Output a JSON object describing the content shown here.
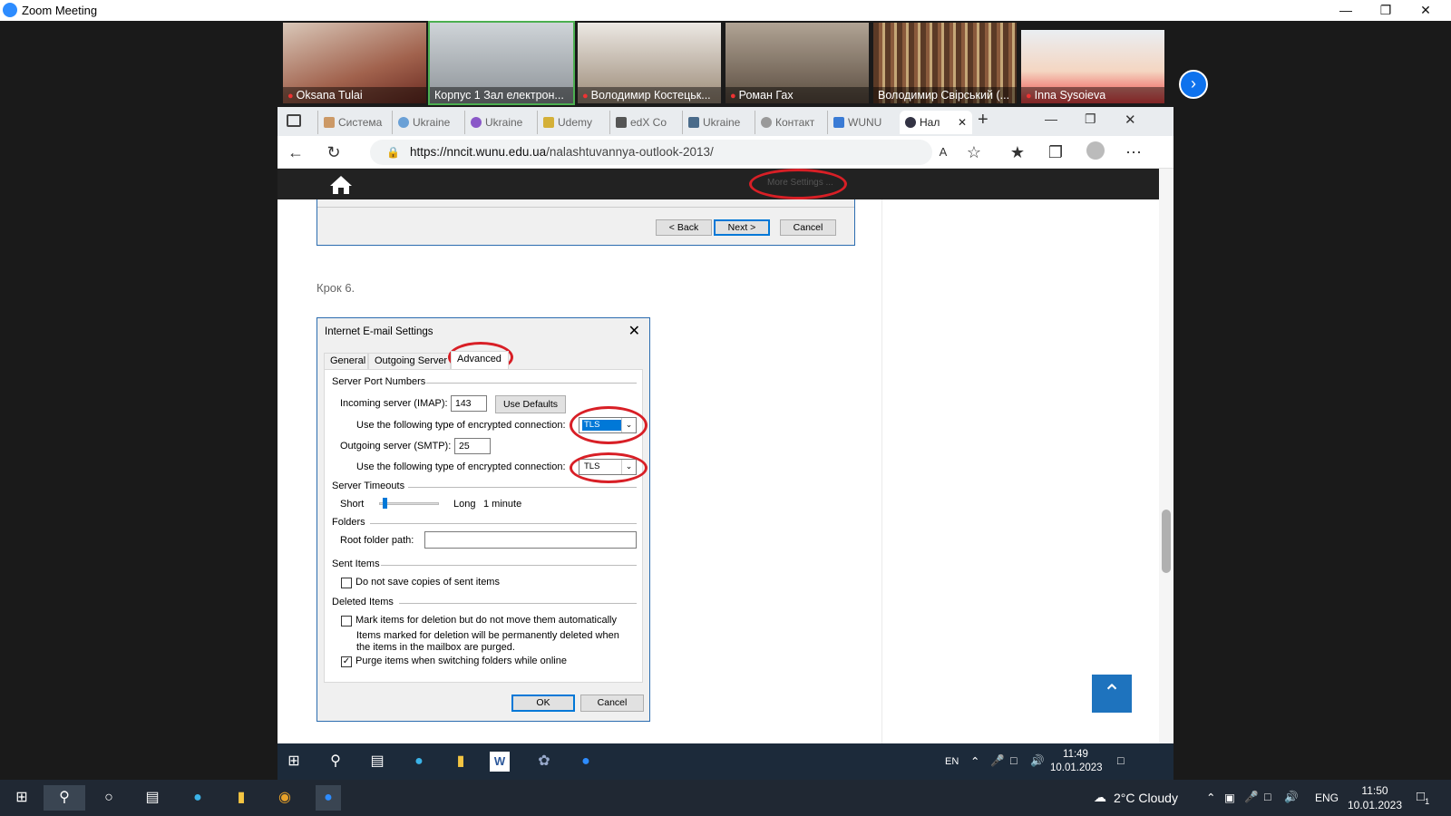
{
  "zoom": {
    "title": "Zoom Meeting",
    "participants": [
      "Oksana Tulai",
      "Корпус 1 Зал електрон...",
      "Володимир Костецьк...",
      "Роман Гах",
      "Володимир Свірський (...",
      "Inna Sysoieva"
    ]
  },
  "browser": {
    "tabs": [
      "Система",
      "Ukraine",
      "Ukraine",
      "Udemy",
      "edX Co",
      "Ukraine",
      "Контакт",
      "WUNU",
      "Нал"
    ],
    "url_host": "https://nncit.wunu.edu.ua",
    "url_path": "/nalashtuvannya-outlook-2013/",
    "read_aloud_icon": "A"
  },
  "page": {
    "more_settings": "More Settings ...",
    "back": "< Back",
    "next": "Next >",
    "cancel": "Cancel",
    "step": "Крок 6."
  },
  "dialog": {
    "title": "Internet E-mail Settings",
    "tabs": [
      "General",
      "Outgoing Server",
      "Advanced"
    ],
    "server_port_numbers": "Server Port Numbers",
    "incoming_label": "Incoming server (IMAP):",
    "incoming_value": "143",
    "use_defaults": "Use Defaults",
    "encrypted_label_1": "Use the following type of encrypted connection:",
    "encryption_1": "TLS",
    "outgoing_label": "Outgoing server (SMTP):",
    "outgoing_value": "25",
    "encrypted_label_2": "Use the following type of encrypted connection:",
    "encryption_2": "TLS",
    "server_timeouts": "Server Timeouts",
    "short": "Short",
    "long": "Long",
    "timeout_value": "1 minute",
    "folders": "Folders",
    "root_folder": "Root folder path:",
    "root_folder_value": "",
    "sent_items": "Sent Items",
    "dont_save": "Do not save copies of sent items",
    "deleted_items": "Deleted Items",
    "mark_items": "Mark items for deletion but do not move them automatically",
    "mark_note_1": "Items marked for deletion will be permanently deleted when",
    "mark_note_2": "the items in the mailbox are purged.",
    "purge": "Purge items when switching folders while online",
    "ok": "OK",
    "cancel": "Cancel"
  },
  "inner_taskbar": {
    "lang": "EN",
    "time": "11:49",
    "date": "10.01.2023"
  },
  "taskbar": {
    "weather": "2°C  Cloudy",
    "lang": "ENG",
    "time": "11:50",
    "date": "10.01.2023",
    "notifications": "1"
  }
}
